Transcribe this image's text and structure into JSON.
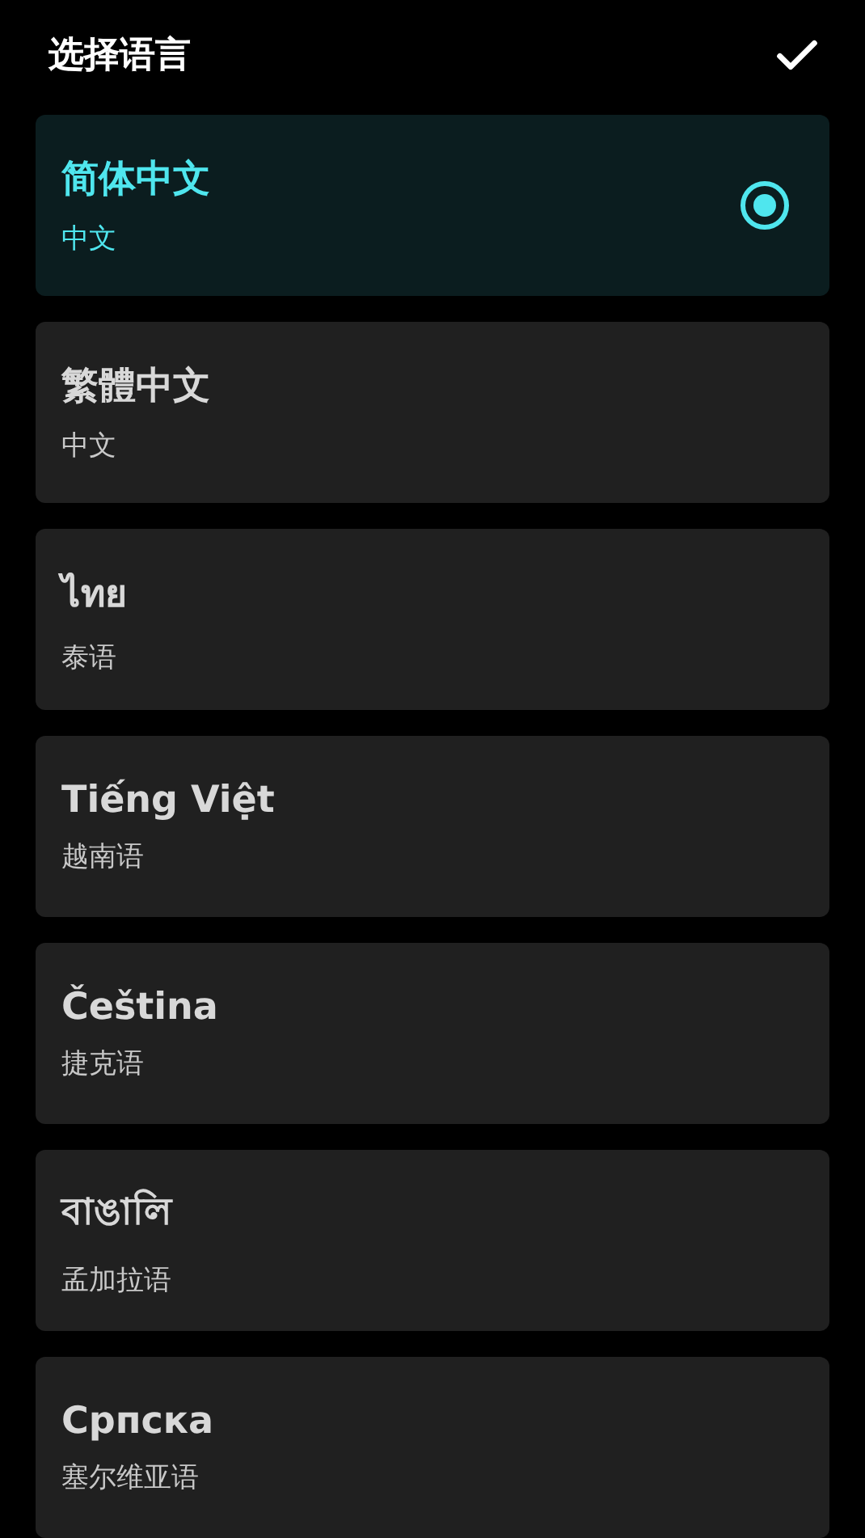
{
  "header": {
    "title": "选择语言"
  },
  "languages": [
    {
      "name": "简体中文",
      "subtitle": "中文",
      "selected": true
    },
    {
      "name": "繁體中文",
      "subtitle": "中文",
      "selected": false
    },
    {
      "name": "ไทย",
      "subtitle": "泰语",
      "selected": false
    },
    {
      "name": "Tiếng Việt",
      "subtitle": "越南语",
      "selected": false
    },
    {
      "name": "Čeština",
      "subtitle": "捷克语",
      "selected": false
    },
    {
      "name": "বাঙালি",
      "subtitle": "孟加拉语",
      "selected": false
    },
    {
      "name": "Српска",
      "subtitle": "塞尔维亚语",
      "selected": false
    }
  ]
}
